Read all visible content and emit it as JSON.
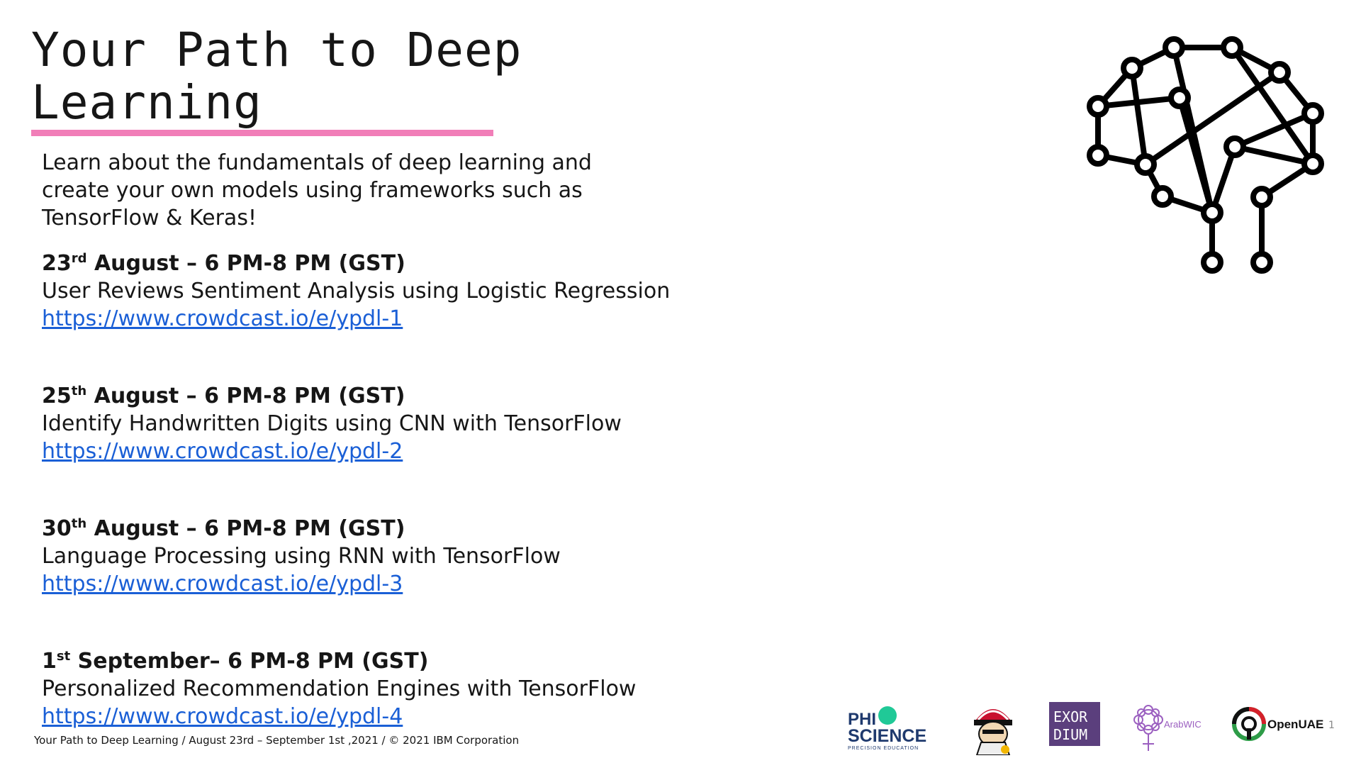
{
  "title": "Your Path to Deep Learning",
  "intro": "Learn about the fundamentals of deep learning and create your own models using frameworks such as TensorFlow & Keras!",
  "sessions": [
    {
      "day": "23",
      "suffix": "rd",
      "rest": " August – 6 PM-8 PM (GST)",
      "topic": "User Reviews Sentiment Analysis using Logistic Regression",
      "link": "https://www.crowdcast.io/e/ypdl-1"
    },
    {
      "day": "25",
      "suffix": "th",
      "rest": " August – 6 PM-8 PM (GST)",
      "topic": "Identify Handwritten Digits using CNN with TensorFlow",
      "link": "https://www.crowdcast.io/e/ypdl-2"
    },
    {
      "day": "30",
      "suffix": "th",
      "rest": " August – 6 PM-8 PM (GST)",
      "topic": "Language Processing using RNN with TensorFlow",
      "link": "https://www.crowdcast.io/e/ypdl-3"
    },
    {
      "day": "1",
      "suffix": "st",
      "rest": " September– 6 PM-8 PM (GST)",
      "topic": "Personalized Recommendation Engines with TensorFlow",
      "link": "https://www.crowdcast.io/e/ypdl-4"
    }
  ],
  "footer": "Your Path to Deep Learning / August 23rd – September 1st ,2021 / © 2021 IBM Corporation",
  "page_number": "1",
  "logos": {
    "phi_line1": "PHI",
    "phi_line2": "SCIENCE",
    "phi_tagline": "PRECISION EDUCATION",
    "exordium_line1": "EXOR",
    "exordium_line2": "DIUM",
    "arabwic": "ArabWIC",
    "openuae": "OpenUAE"
  },
  "colors": {
    "accent_bar": "#f17eb8",
    "link": "#1a5fd6",
    "exordium_bg": "#5b3f7d",
    "openuae_green": "#2e9c48",
    "phi_green": "#20c997"
  },
  "icons": [
    "brain-network-icon"
  ]
}
